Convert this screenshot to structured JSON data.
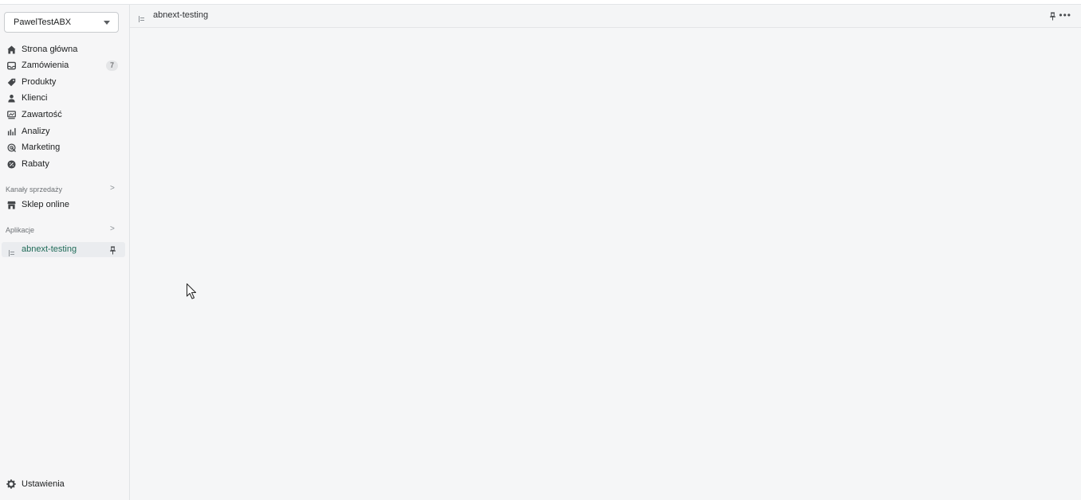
{
  "sidebar": {
    "store_name": "PawelTestABX",
    "items": [
      {
        "label": "Strona główna",
        "icon": "home-icon"
      },
      {
        "label": "Zamówienia",
        "icon": "inbox-icon",
        "badge": "7"
      },
      {
        "label": "Produkty",
        "icon": "tag-icon"
      },
      {
        "label": "Klienci",
        "icon": "person-icon"
      },
      {
        "label": "Zawartość",
        "icon": "content-icon"
      },
      {
        "label": "Analizy",
        "icon": "analytics-icon"
      },
      {
        "label": "Marketing",
        "icon": "marketing-icon"
      },
      {
        "label": "Rabaty",
        "icon": "discount-icon"
      }
    ],
    "sales_channels": {
      "title": "Kanały sprzedaży",
      "items": [
        {
          "label": "Sklep online",
          "icon": "store-icon"
        }
      ]
    },
    "apps": {
      "title": "Aplikacje",
      "items": [
        {
          "label": "abnext-testing",
          "icon": "app-icon",
          "active": true
        }
      ]
    },
    "settings_label": "Ustawienia"
  },
  "header": {
    "title": "abnext-testing",
    "more": "•••"
  },
  "colors": {
    "active_text": "#1f6b58",
    "sidebar_bg": "#f6f6f7",
    "main_bg": "#f4f5f6"
  }
}
